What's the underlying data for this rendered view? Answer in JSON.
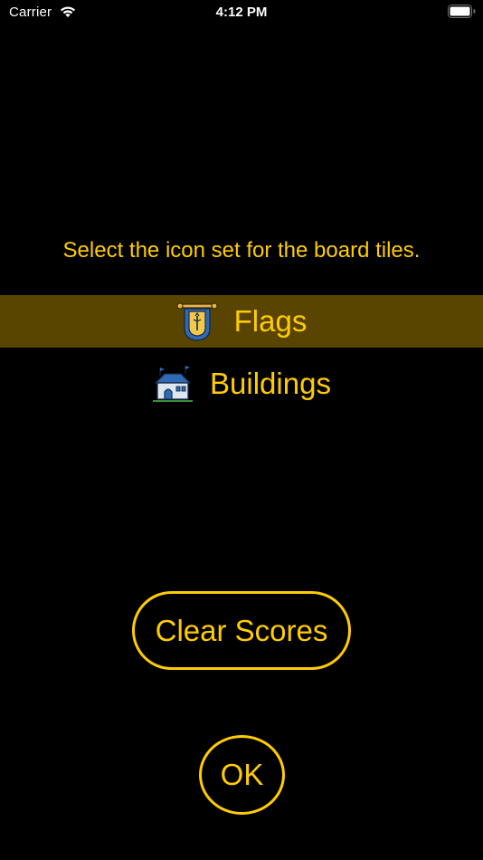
{
  "status_bar": {
    "carrier": "Carrier",
    "time": "4:12 PM",
    "wifi_icon": "wifi-icon",
    "battery_icon": "battery-icon"
  },
  "instruction": "Select the icon set for the board tiles.",
  "icon_sets": [
    {
      "label": "Flags",
      "icon": "banner-flag-icon",
      "selected": true
    },
    {
      "label": "Buildings",
      "icon": "house-icon",
      "selected": false
    }
  ],
  "buttons": {
    "clear_scores": "Clear Scores",
    "ok": "OK"
  },
  "colors": {
    "background": "#000000",
    "accent": "#FFCC00",
    "selected_row": "#5A4500",
    "status_text": "#FFFFFF"
  }
}
